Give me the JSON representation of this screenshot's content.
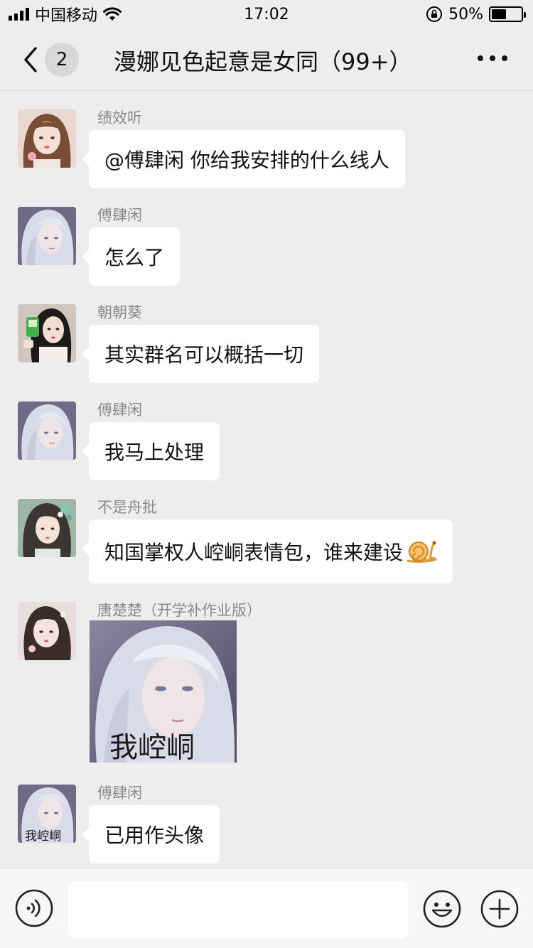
{
  "status_bar": {
    "carrier": "中国移动",
    "time": "17:02",
    "battery_percent_label": "50%",
    "battery_level": 0.5
  },
  "nav": {
    "back_icon": "chevron-left-icon",
    "unread_count": "2",
    "title": "漫娜见色起意是女同（99+）",
    "more_icon": "more-dots-icon"
  },
  "messages": [
    {
      "sender": "绩效听",
      "text": "@傅肆闲 你给我安排的什么线人",
      "avatar": "avatar-girl-brown-hair"
    },
    {
      "sender": "傅肆闲",
      "text": "怎么了",
      "avatar": "avatar-silver-hair-man"
    },
    {
      "sender": "朝朝葵",
      "text": "其实群名可以概括一切",
      "avatar": "avatar-girl-dark-hair"
    },
    {
      "sender": "傅肆闲",
      "text": "我马上处理",
      "avatar": "avatar-silver-hair-man"
    },
    {
      "sender": "不是舟批",
      "text": "知国掌权人崆峒表情包，谁来建设",
      "emoji": "snail-emoji",
      "avatar": "avatar-girl-floral"
    },
    {
      "sender": "唐楚楚（开学补作业版）",
      "image_caption": "我崆峒",
      "avatar": "avatar-girl-hair-clip"
    },
    {
      "sender": "傅肆闲",
      "text": "已用作头像",
      "avatar_caption": "我崆峒",
      "avatar": "avatar-silver-hair-man-captioned"
    }
  ],
  "input_bar": {
    "voice_icon": "voice-icon",
    "input_value": "",
    "emoji_icon": "emoji-smile-icon",
    "plus_icon": "plus-circle-icon"
  },
  "colors": {
    "background": "#ededed",
    "bubble": "#ffffff",
    "sender_name": "#8a8a8a",
    "input_bar": "#f6f6f6"
  }
}
